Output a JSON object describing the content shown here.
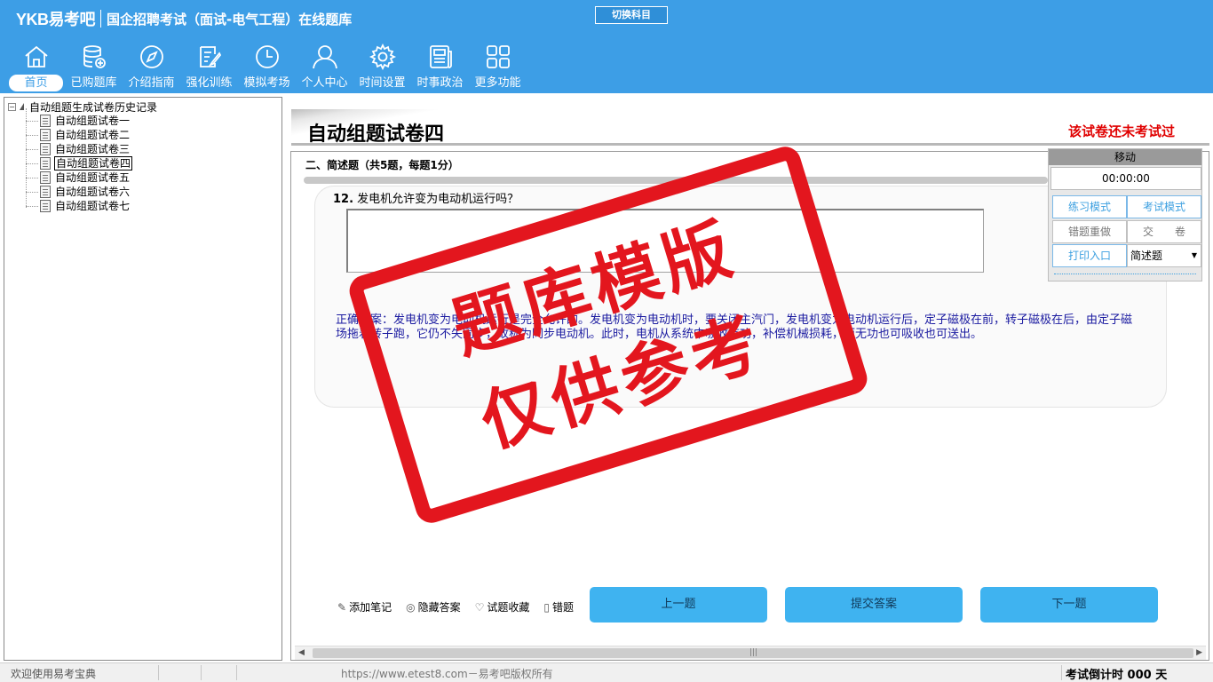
{
  "header": {
    "logo": "YKB易考吧",
    "app_title": "国企招聘考试（面试-电气工程）在线题库",
    "switch_subject": "切换科目"
  },
  "nav": [
    {
      "label": "首页",
      "icon": "home-icon"
    },
    {
      "label": "已购题库",
      "icon": "database-icon"
    },
    {
      "label": "介绍指南",
      "icon": "compass-icon"
    },
    {
      "label": "强化训练",
      "icon": "edit-icon"
    },
    {
      "label": "模拟考场",
      "icon": "clock-icon"
    },
    {
      "label": "个人中心",
      "icon": "user-icon"
    },
    {
      "label": "时间设置",
      "icon": "gear-icon"
    },
    {
      "label": "时事政治",
      "icon": "news-icon"
    },
    {
      "label": "更多功能",
      "icon": "grid-icon"
    }
  ],
  "tree": {
    "root": "自动组题生成试卷历史记录",
    "items": [
      "自动组题试卷一",
      "自动组题试卷二",
      "自动组题试卷三",
      "自动组题试卷四",
      "自动组题试卷五",
      "自动组题试卷六",
      "自动组题试卷七"
    ],
    "selected_index": 3
  },
  "paper": {
    "title": "自动组题试卷四",
    "status": "该试卷还未考试过"
  },
  "question": {
    "section": "二、简述题（共5题，每题1分）",
    "number": "12.",
    "text": "发电机允许变为电动机运行吗？",
    "answer_value": "",
    "correct_answer": "正确答案：发电机变为电动机运行是完全允许的。发电机变为电动机时，要关闭主汽门，发电机变为电动机运行后，定子磁极在前，转子磁极在后，由定子磁场拖着转子跑，它仍不失同步，故称为同步电动机。此时，电机从系统中吸收有功，补偿机械损耗，而无功也可吸收也可送出。"
  },
  "tools": [
    {
      "label": "添加笔记",
      "icon": "pencil-icon"
    },
    {
      "label": "隐藏答案",
      "icon": "eye-icon"
    },
    {
      "label": "试题收藏",
      "icon": "heart-icon"
    },
    {
      "label": "错题",
      "icon": "book-icon"
    }
  ],
  "buttons": {
    "prev": "上一题",
    "submit": "提交答案",
    "next": "下一题"
  },
  "timer_panel": {
    "move": "移动",
    "time": "00:00:00",
    "practice_mode": "练习模式",
    "exam_mode": "考试模式",
    "redo_wrong": "错题重做",
    "hand_in": "交　　卷",
    "print": "打印入口",
    "question_type": "简述题"
  },
  "watermark": {
    "line1": "题库模版",
    "line2": "仅供参考"
  },
  "statusbar": {
    "welcome": "欢迎使用易考宝典",
    "copyright": "https://www.etest8.com－易考吧版权所有",
    "countdown": "考试倒计时 000 天"
  },
  "colors": {
    "header_bg": "#3d9ee6",
    "button_bg": "#3fb3f0",
    "status_red": "#e00000",
    "stamp_red": "#e3161e",
    "answer_text": "#1a1aa0"
  }
}
